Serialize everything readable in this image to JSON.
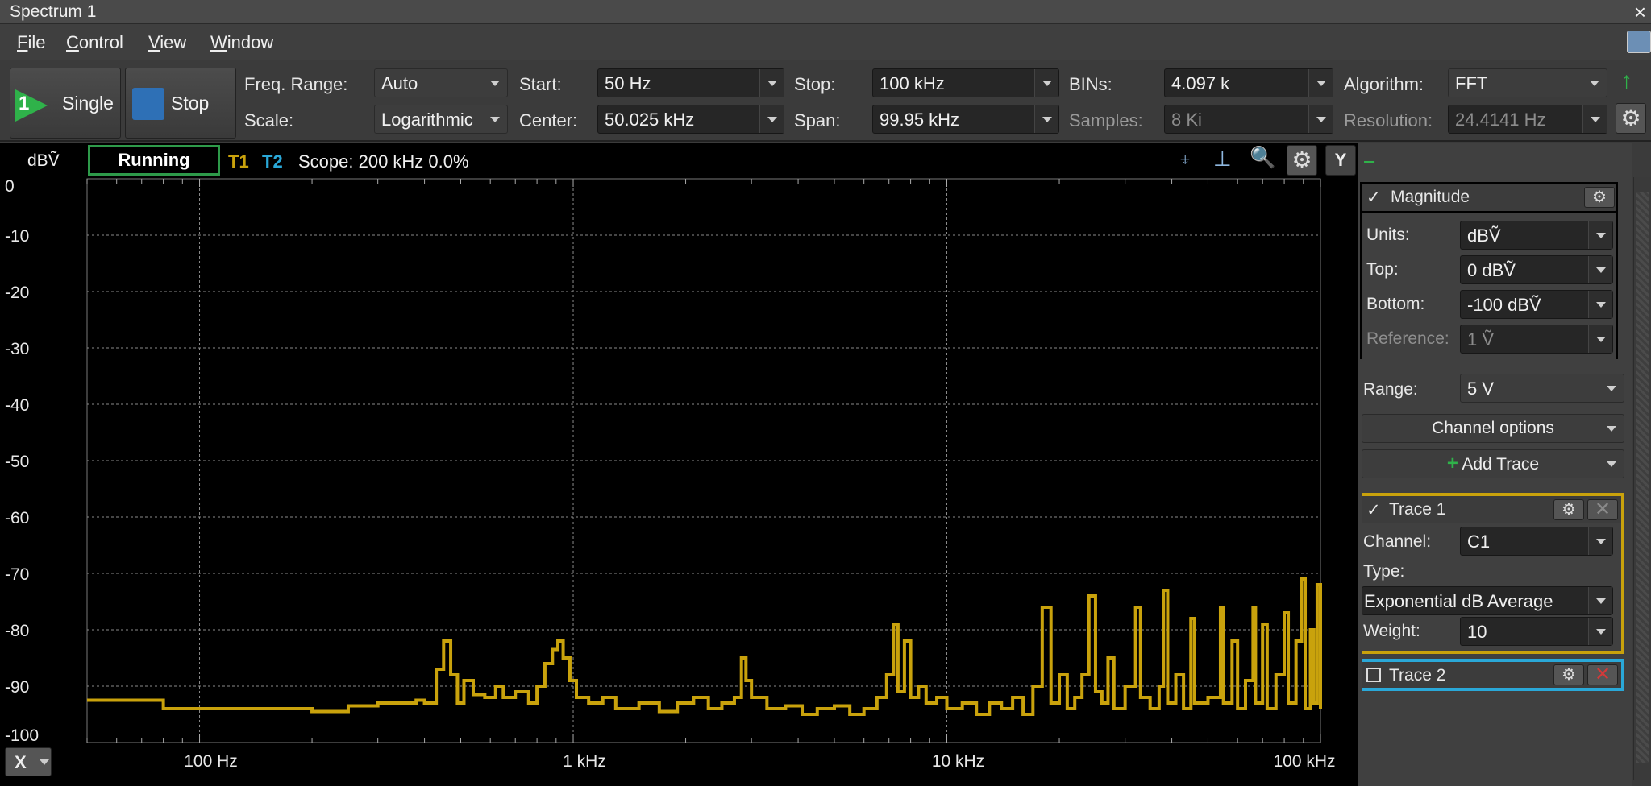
{
  "window": {
    "title": "Spectrum 1",
    "close": "×"
  },
  "menu": [
    "File",
    "Control",
    "View",
    "Window"
  ],
  "toolbar": {
    "single_label": "Single",
    "single_num": "1",
    "stop_label": "Stop",
    "freq_range": {
      "label": "Freq. Range:",
      "value": "Auto"
    },
    "scale": {
      "label": "Scale:",
      "value": "Logarithmic"
    },
    "start": {
      "label": "Start:",
      "value": "50 Hz"
    },
    "center": {
      "label": "Center:",
      "value": "50.025 kHz"
    },
    "stop": {
      "label": "Stop:",
      "value": "100 kHz"
    },
    "span": {
      "label": "Span:",
      "value": "99.95 kHz"
    },
    "bins": {
      "label": "BINs:",
      "value": "4.097 k"
    },
    "samples": {
      "label": "Samples:",
      "value": "8 Ki"
    },
    "algorithm": {
      "label": "Algorithm:",
      "value": "FFT"
    },
    "resolution": {
      "label": "Resolution:",
      "value": "24.4141 Hz"
    }
  },
  "plot_header": {
    "unit": "dBṼ",
    "status": "Running",
    "t1": "T1",
    "t2": "T2",
    "scope": "Scope: 200 kHz 0.0%",
    "y_button": "Y",
    "x_button": "X"
  },
  "colors": {
    "trace1": "#c9a20c",
    "trace2": "#2aa8d8",
    "running_border": "#2e9a4a",
    "grid": "#8a8a8a"
  },
  "chart_data": {
    "type": "line",
    "title": "",
    "xlabel": "",
    "ylabel": "dBṼ",
    "x_scale": "log",
    "xlim": [
      50,
      100000
    ],
    "ylim": [
      -100,
      0
    ],
    "y_ticks": [
      "0",
      "-10",
      "-20",
      "-30",
      "-40",
      "-50",
      "-60",
      "-70",
      "-80",
      "-90",
      "-100"
    ],
    "x_ticks": [
      "100 Hz",
      "1 kHz",
      "10 kHz",
      "100 kHz"
    ],
    "series": [
      {
        "name": "T1",
        "points": [
          [
            50,
            -92.5
          ],
          [
            70,
            -92.5
          ],
          [
            80,
            -94
          ],
          [
            150,
            -94
          ],
          [
            200,
            -94.5
          ],
          [
            250,
            -93.5
          ],
          [
            300,
            -93
          ],
          [
            350,
            -93
          ],
          [
            380,
            -92.5
          ],
          [
            400,
            -93
          ],
          [
            430,
            -87
          ],
          [
            450,
            -82
          ],
          [
            470,
            -88
          ],
          [
            490,
            -93
          ],
          [
            510,
            -89
          ],
          [
            540,
            -91.5
          ],
          [
            580,
            -92
          ],
          [
            620,
            -90
          ],
          [
            650,
            -92
          ],
          [
            700,
            -91
          ],
          [
            760,
            -93
          ],
          [
            800,
            -90
          ],
          [
            840,
            -86
          ],
          [
            880,
            -83.5
          ],
          [
            910,
            -82
          ],
          [
            940,
            -85
          ],
          [
            980,
            -89
          ],
          [
            1020,
            -92
          ],
          [
            1100,
            -93
          ],
          [
            1200,
            -92
          ],
          [
            1300,
            -94
          ],
          [
            1500,
            -93
          ],
          [
            1700,
            -94.5
          ],
          [
            1900,
            -93
          ],
          [
            2100,
            -92
          ],
          [
            2300,
            -94
          ],
          [
            2500,
            -93
          ],
          [
            2700,
            -92
          ],
          [
            2820,
            -85
          ],
          [
            2900,
            -89
          ],
          [
            3000,
            -92
          ],
          [
            3300,
            -94
          ],
          [
            3700,
            -93.5
          ],
          [
            4100,
            -95
          ],
          [
            4500,
            -94
          ],
          [
            5000,
            -93.5
          ],
          [
            5500,
            -95
          ],
          [
            6000,
            -94
          ],
          [
            6500,
            -92
          ],
          [
            6900,
            -88
          ],
          [
            7200,
            -79
          ],
          [
            7400,
            -91
          ],
          [
            7700,
            -82
          ],
          [
            8000,
            -92
          ],
          [
            8400,
            -90
          ],
          [
            8800,
            -93
          ],
          [
            9400,
            -92
          ],
          [
            10000,
            -94
          ],
          [
            11000,
            -93
          ],
          [
            12000,
            -95
          ],
          [
            13000,
            -93
          ],
          [
            14000,
            -94
          ],
          [
            15000,
            -92
          ],
          [
            16000,
            -95
          ],
          [
            17000,
            -90
          ],
          [
            18000,
            -76
          ],
          [
            19000,
            -93
          ],
          [
            20000,
            -88
          ],
          [
            21000,
            -94
          ],
          [
            22000,
            -92
          ],
          [
            23000,
            -88
          ],
          [
            24000,
            -74
          ],
          [
            25000,
            -91
          ],
          [
            26000,
            -93
          ],
          [
            27000,
            -85
          ],
          [
            28000,
            -94
          ],
          [
            30000,
            -90
          ],
          [
            32000,
            -76
          ],
          [
            33000,
            -92
          ],
          [
            35000,
            -94
          ],
          [
            37000,
            -90
          ],
          [
            38000,
            -73
          ],
          [
            39000,
            -93
          ],
          [
            41000,
            -88
          ],
          [
            43000,
            -94
          ],
          [
            45000,
            -78
          ],
          [
            46000,
            -93
          ],
          [
            50000,
            -92
          ],
          [
            54000,
            -76
          ],
          [
            55000,
            -93
          ],
          [
            58000,
            -82
          ],
          [
            60000,
            -94
          ],
          [
            63000,
            -89
          ],
          [
            66000,
            -76
          ],
          [
            67000,
            -93
          ],
          [
            70000,
            -79
          ],
          [
            72000,
            -94
          ],
          [
            76000,
            -88
          ],
          [
            80000,
            -77
          ],
          [
            82000,
            -93
          ],
          [
            86000,
            -82
          ],
          [
            89000,
            -71
          ],
          [
            91000,
            -94
          ],
          [
            94000,
            -80
          ],
          [
            96000,
            -93
          ],
          [
            98000,
            -72
          ],
          [
            100000,
            -94
          ]
        ]
      }
    ],
    "grid": true
  },
  "right_panel": {
    "magnitude": {
      "title": "Magnitude",
      "check": "✓",
      "units": {
        "label": "Units:",
        "value": "dBṼ"
      },
      "top": {
        "label": "Top:",
        "value": "0 dBṼ"
      },
      "bottom": {
        "label": "Bottom:",
        "value": "-100 dBṼ"
      },
      "reference": {
        "label": "Reference:",
        "value": "1 Ṽ"
      }
    },
    "range": {
      "label": "Range:",
      "value": "5 V"
    },
    "channel_options": "Channel options",
    "add_trace": "Add Trace",
    "trace1": {
      "title": "Trace 1",
      "check": "✓",
      "channel": {
        "label": "Channel:",
        "value": "C1"
      },
      "type": {
        "label": "Type:",
        "value": "Exponential dB Average"
      },
      "weight": {
        "label": "Weight:",
        "value": "10"
      }
    },
    "trace2": {
      "title": "Trace 2"
    }
  }
}
